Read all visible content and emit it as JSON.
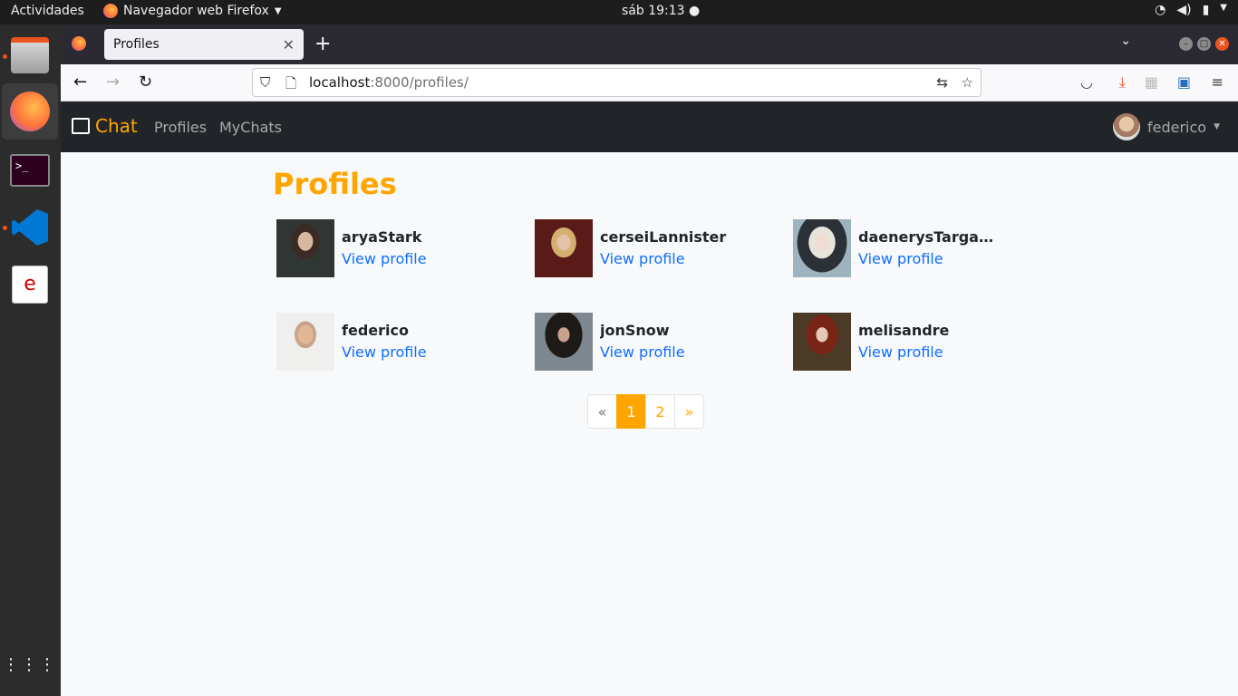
{
  "system": {
    "activities": "Actividades",
    "app_name": "Navegador web Firefox",
    "clock": "sáb 19:13"
  },
  "browser": {
    "tab_title": "Profiles",
    "url_host": "localhost",
    "url_rest": ":8000/profiles/"
  },
  "site": {
    "brand": "Chat",
    "nav": [
      "Profiles",
      "MyChats"
    ],
    "user": "federico",
    "accent": "#ffa500",
    "link_color": "#0d6efd"
  },
  "main": {
    "title": "Profiles",
    "profiles": [
      {
        "name": "aryaStark",
        "link": "View profile"
      },
      {
        "name": "cerseiLannister",
        "link": "View profile"
      },
      {
        "name": "daenerysTargary...",
        "link": "View profile"
      },
      {
        "name": "federico",
        "link": "View profile"
      },
      {
        "name": "jonSnow",
        "link": "View profile"
      },
      {
        "name": "melisandre",
        "link": "View profile"
      }
    ],
    "pagination": {
      "prev": "«",
      "pages": [
        "1",
        "2"
      ],
      "current": "1",
      "next": "»"
    }
  }
}
